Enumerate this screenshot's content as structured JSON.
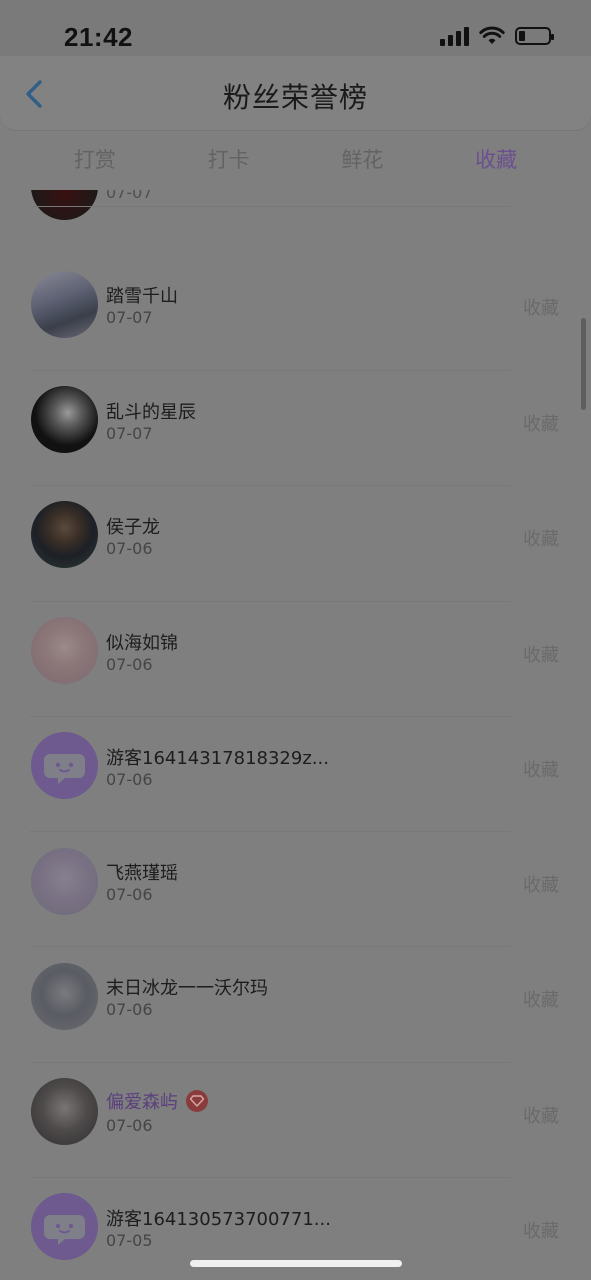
{
  "status_bar": {
    "time": "21:42"
  },
  "header": {
    "title": "粉丝荣誉榜",
    "back_icon": "chevron-left-icon"
  },
  "tabs": [
    {
      "label": "打赏",
      "active": false
    },
    {
      "label": "打卡",
      "active": false
    },
    {
      "label": "鲜花",
      "active": false
    },
    {
      "label": "收藏",
      "active": true
    }
  ],
  "partial_row": {
    "date": "07-07"
  },
  "list": [
    {
      "name": "踏雪千山",
      "date": "07-07",
      "action": "收藏"
    },
    {
      "name": "乱斗的星辰",
      "date": "07-07",
      "action": "收藏"
    },
    {
      "name": "侯子龙",
      "date": "07-06",
      "action": "收藏"
    },
    {
      "name": "似海如锦",
      "date": "07-06",
      "action": "收藏"
    },
    {
      "name": "游客16414317818329z...",
      "date": "07-06",
      "action": "收藏"
    },
    {
      "name": "飞燕瑾瑶",
      "date": "07-06",
      "action": "收藏"
    },
    {
      "name": "末日冰龙一一沃尔玛",
      "date": "07-06",
      "action": "收藏"
    },
    {
      "name": "偏爱森屿",
      "date": "07-06",
      "action": "收藏"
    },
    {
      "name": "游客164130573700771...",
      "date": "07-05",
      "action": "收藏"
    }
  ],
  "colors": {
    "accent": "#6b4f8f",
    "overlay": "#7f7f7f",
    "guest_avatar": "#6e5a8e"
  }
}
